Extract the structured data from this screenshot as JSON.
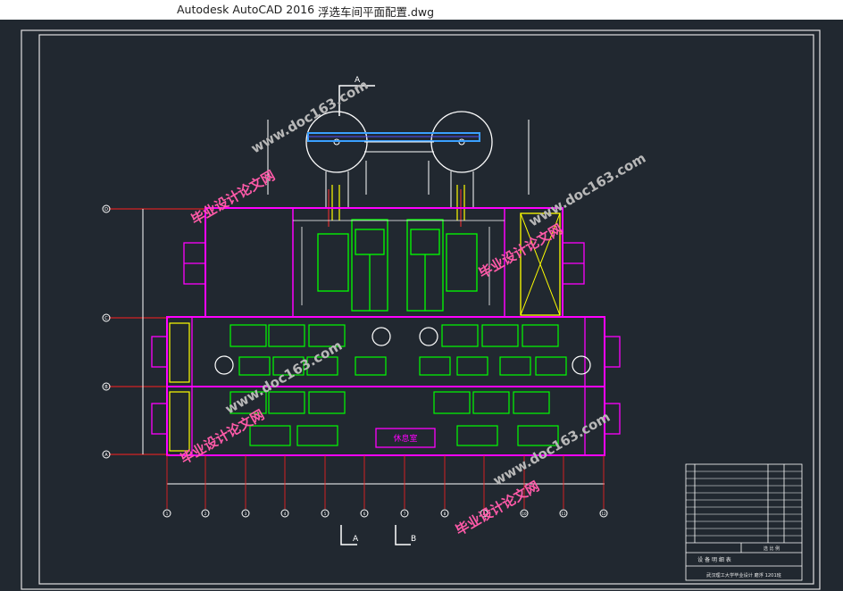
{
  "window": {
    "app_title": "Autodesk AutoCAD 2016",
    "file_title": "浮选车间平面配置.dwg"
  },
  "drawing": {
    "section_a": "A",
    "section_b": "B",
    "room_label": "休息室",
    "grid_rows": [
      "D",
      "C",
      "B",
      "A"
    ],
    "grid_cols": [
      "1",
      "2",
      "3",
      "4",
      "5",
      "6",
      "7",
      "8",
      "9",
      "10",
      "11",
      "12"
    ],
    "watermark_site": "www.doc163.com",
    "watermark_brand": "毕业设计论文网"
  },
  "title_block": {
    "table_heading": "设 备 明 细 表",
    "school_line": "武汉理工大学毕业设计 磨浮 1201班",
    "small_label": "选 比 例"
  },
  "colors": {
    "background": "#212830",
    "magenta": "#ff00ff",
    "green": "#00ff00",
    "yellow": "#ffff00",
    "red": "#ff0000",
    "white": "#ffffff",
    "cyan": "#00d8ff"
  }
}
